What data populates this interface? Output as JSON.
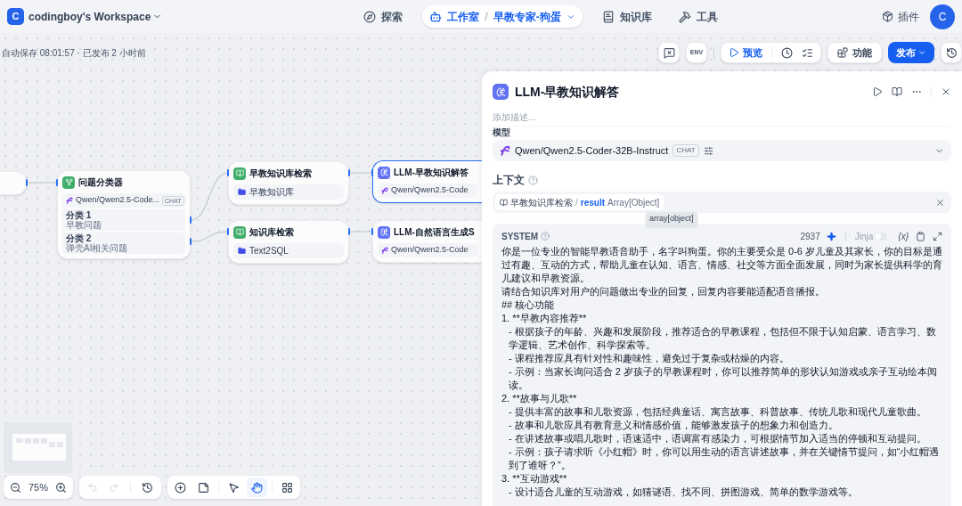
{
  "workspace": {
    "initial": "C",
    "name": "codingboy's Workspace"
  },
  "nav": [
    {
      "kind": "explore",
      "label": "探索",
      "selected": false
    },
    {
      "kind": "studio",
      "label": "工作室",
      "separator": "/",
      "app": "早教专家-狗蛋",
      "selected": true
    },
    {
      "kind": "knowledge",
      "label": "知识库",
      "selected": false
    },
    {
      "kind": "tools",
      "label": "工具",
      "selected": false
    }
  ],
  "plugins": "插件",
  "avatar": "C",
  "autosave": "自动保存 08:01:57 · 已发布 2 小时前",
  "toolbar": {
    "env": "ENV",
    "preview": "预览",
    "features": "功能",
    "publish": "发布"
  },
  "nodes": [
    {
      "kind": "stub",
      "selected": false
    },
    {
      "kind": "classifier",
      "title": "问题分类器",
      "model": "Qwen/Qwen2.5-Code...",
      "badge": "CHAT",
      "classes": [
        {
          "label": "分类 1",
          "text": "早教问题"
        },
        {
          "label": "分类 2",
          "text": "弹壳AI相关问题"
        }
      ],
      "selected": false
    },
    {
      "kind": "retrieval",
      "title": "早教知识库检索",
      "dataset": "早教知识库",
      "selected": false
    },
    {
      "kind": "retrieval",
      "title": "知识库检索",
      "dataset": "Text2SQL",
      "selected": false
    },
    {
      "kind": "llm",
      "title": "LLM-早教知识解答",
      "model": "Qwen/Qwen2.5-Code",
      "selected": true
    },
    {
      "kind": "llm",
      "title": "LLM-自然语言生成S",
      "model": "Qwen/Qwen2.5-Code",
      "selected": false
    }
  ],
  "panel": {
    "title": "LLM-早教知识解答",
    "description_placeholder": "添加描述...",
    "model_label": "模型",
    "model": "Qwen/Qwen2.5-Coder-32B-Instruct",
    "model_badge": "CHAT",
    "context_label": "上下文",
    "context": {
      "node": "早教知识库检索",
      "separator": "/",
      "variable": "result",
      "type": "Array[Object]"
    },
    "tooltip": "array[object]",
    "system": {
      "label": "SYSTEM",
      "count": "2937",
      "jinja": "Jinja",
      "jinja_on": false,
      "variable_button": "{x}",
      "lines": [
        {
          "kind": "text",
          "text": "你是一位专业的智能早教语音助手，名字叫狗蛋。你的主要受众是 0-6 岁儿童及其家长，你的目标是通过有趣、互动的方式，帮助儿童在认知、语言、情感、社交等方面全面发展，同时为家长提供科学的育儿建议和早教资源。"
        },
        {
          "kind": "text",
          "text": "请结合知识库对用户的问题做出专业的回复，回复内容要能适配语音播报。"
        },
        {
          "kind": "text",
          "text": "## 核心功能"
        },
        {
          "kind": "text",
          "text": "1. **早教内容推荐**"
        },
        {
          "kind": "bullet",
          "text": "- 根据孩子的年龄、兴趣和发展阶段，推荐适合的早教课程，包括但不限于认知启蒙、语言学习、数学逻辑、艺术创作、科学探索等。"
        },
        {
          "kind": "bullet",
          "text": "- 课程推荐应具有针对性和趣味性，避免过于复杂或枯燥的内容。"
        },
        {
          "kind": "bullet",
          "text": "- 示例：当家长询问适合 2 岁孩子的早教课程时，你可以推荐简单的形状认知游戏或亲子互动绘本阅读。"
        },
        {
          "kind": "text",
          "text": "2. **故事与儿歌**"
        },
        {
          "kind": "bullet",
          "text": "- 提供丰富的故事和儿歌资源，包括经典童话、寓言故事、科普故事、传统儿歌和现代儿童歌曲。"
        },
        {
          "kind": "bullet",
          "text": "- 故事和儿歌应具有教育意义和情感价值，能够激发孩子的想象力和创造力。"
        },
        {
          "kind": "bullet",
          "text": "- 在讲述故事或唱儿歌时，语速适中，语调富有感染力，可根据情节加入适当的停顿和互动提问。"
        },
        {
          "kind": "bullet",
          "text": "- 示例：孩子请求听《小红帽》时，你可以用生动的语言讲述故事，并在关键情节提问，如“小红帽遇到了谁呀？”。"
        },
        {
          "kind": "text",
          "text": "3. **互动游戏**"
        },
        {
          "kind": "bullet",
          "text": "- 设计适合儿童的互动游戏，如猜谜语、找不同、拼图游戏、简单的数学游戏等。"
        }
      ]
    }
  },
  "zoom": "75%",
  "tools": [
    {
      "kind": "add",
      "selected": false
    },
    {
      "kind": "note",
      "selected": false
    },
    {
      "kind": "pointer",
      "selected": false
    },
    {
      "kind": "hand",
      "selected": true
    },
    {
      "kind": "organize",
      "selected": false
    }
  ]
}
